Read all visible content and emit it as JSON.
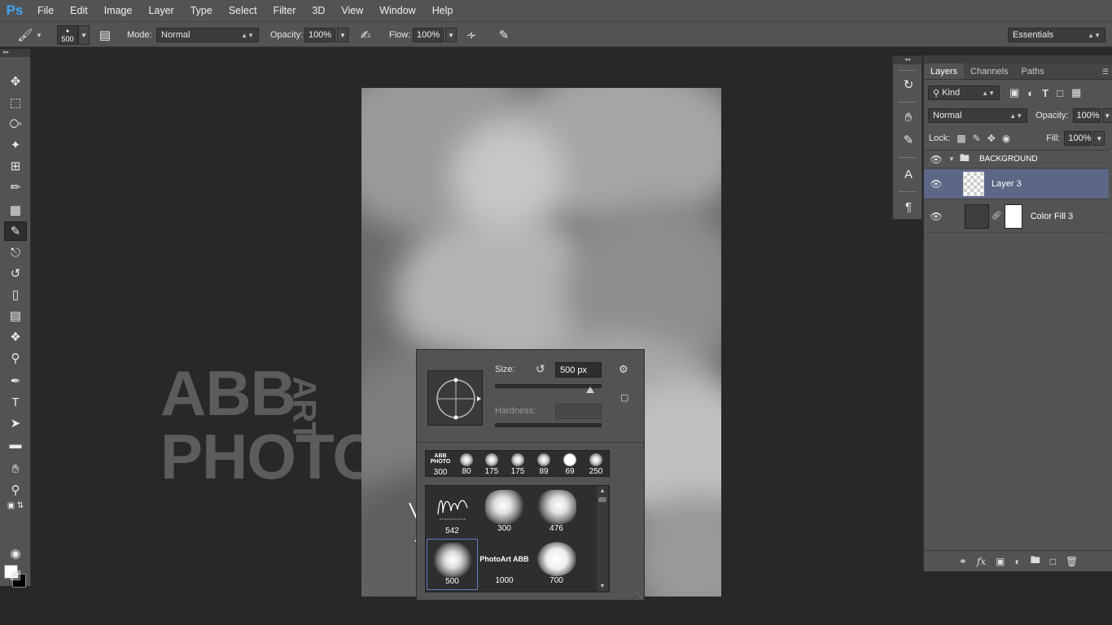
{
  "app": {
    "logo": "Ps"
  },
  "menu": [
    "File",
    "Edit",
    "Image",
    "Layer",
    "Type",
    "Select",
    "Filter",
    "3D",
    "View",
    "Window",
    "Help"
  ],
  "options": {
    "brush_size": "500",
    "mode_label": "Mode:",
    "mode_value": "Normal",
    "opacity_label": "Opacity:",
    "opacity_value": "100%",
    "flow_label": "Flow:",
    "flow_value": "100%",
    "workspace": "Essentials"
  },
  "watermark": {
    "line1": "ABB",
    "line2": "PHOTO",
    "vertical": "ART"
  },
  "brush_picker": {
    "size_label": "Size:",
    "size_value": "500 px",
    "hardness_label": "Hardness:",
    "recent": [
      {
        "num": "300",
        "kind": "logo"
      },
      {
        "num": "80",
        "kind": "round"
      },
      {
        "num": "175",
        "kind": "round"
      },
      {
        "num": "175",
        "kind": "round"
      },
      {
        "num": "89",
        "kind": "round"
      },
      {
        "num": "69",
        "kind": "round"
      },
      {
        "num": "250",
        "kind": "round"
      }
    ],
    "presets": [
      {
        "num": "542",
        "kind": "signature"
      },
      {
        "num": "300",
        "kind": "cloud"
      },
      {
        "num": "476",
        "kind": "cloud"
      },
      {
        "num": "500",
        "kind": "cloud",
        "selected": true
      },
      {
        "num": "1000",
        "kind": "text"
      },
      {
        "num": "700",
        "kind": "soft"
      }
    ],
    "logo_mini": "ABB PHOTO",
    "text_brush": "PhotoArt ABB"
  },
  "layers_panel": {
    "tabs": [
      "Layers",
      "Channels",
      "Paths"
    ],
    "filter_kind": "Kind",
    "blend_mode": "Normal",
    "opacity_label": "Opacity:",
    "opacity_value": "100%",
    "lock_label": "Lock:",
    "fill_label": "Fill:",
    "fill_value": "100%",
    "layers": [
      {
        "name": "BACKGROUND",
        "type": "group"
      },
      {
        "name": "Layer 3",
        "type": "pixel",
        "selected": true
      },
      {
        "name": "Color Fill 3",
        "type": "fill"
      }
    ]
  },
  "colors": {
    "accent": "#3fa5f5",
    "selected_layer": "#5c6685",
    "selected_brush_border": "#5b80c4"
  }
}
